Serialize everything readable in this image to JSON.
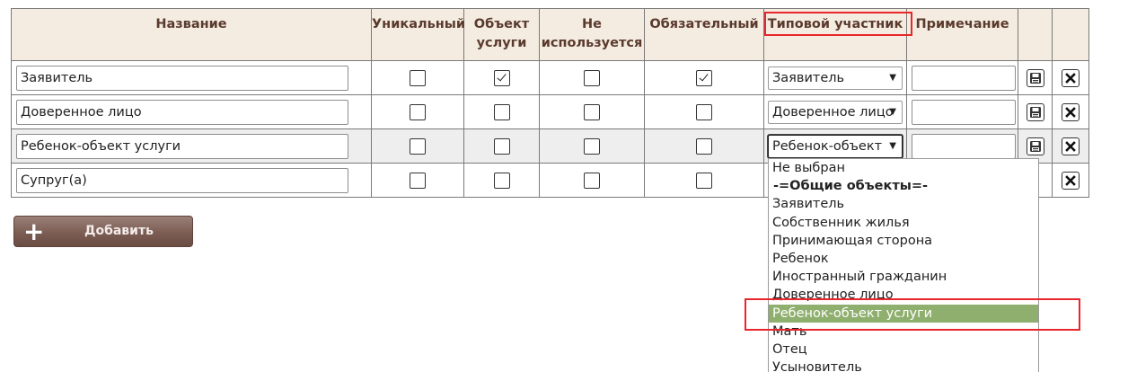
{
  "table": {
    "headers": {
      "name": "Название",
      "unique": "Уникальный",
      "service_object_1": "Объект",
      "service_object_2": "услуги",
      "unused_1": "Не",
      "unused_2": "используется",
      "required": "Обязательный",
      "typical_participant": "Типовой участник",
      "note": "Примечание"
    },
    "rows": [
      {
        "name": "Заявитель",
        "unique": false,
        "service_object": true,
        "unused": false,
        "required": true,
        "typical_participant": "Заявитель",
        "note": ""
      },
      {
        "name": "Доверенное лицо",
        "unique": false,
        "service_object": false,
        "unused": false,
        "required": false,
        "typical_participant": "Доверенное лицо",
        "note": ""
      },
      {
        "name": "Ребенок-объект услуги",
        "unique": false,
        "service_object": false,
        "unused": false,
        "required": false,
        "typical_participant": "Ребенок-объект",
        "note": ""
      },
      {
        "name": "Супруг(а)",
        "unique": false,
        "service_object": false,
        "unused": false,
        "required": false,
        "typical_participant": "",
        "note": ""
      }
    ]
  },
  "add_button": {
    "label": "Добавить",
    "icon": "plus-icon"
  },
  "dropdown": {
    "options": [
      "Не выбран",
      "-=Общие объекты=-",
      "Заявитель",
      "Собственник жилья",
      "Принимающая сторона",
      "Ребенок",
      "Иностранный гражданин",
      "Доверенное лицо",
      "Ребенок-объект услуги",
      "Мать",
      "Отец",
      "Усыновитель"
    ],
    "highlighted": "Ребенок-объект услуги"
  },
  "icons": {
    "save": "floppy-disk-icon",
    "delete": "close-icon",
    "dropdown": "chevron-down-icon"
  },
  "colors": {
    "header_bg": "#f4ece0",
    "header_text": "#5b3a2e",
    "highlight_option": "#8faf6e",
    "add_button": "#7c5d54",
    "annotation_red": "#e8262b"
  }
}
